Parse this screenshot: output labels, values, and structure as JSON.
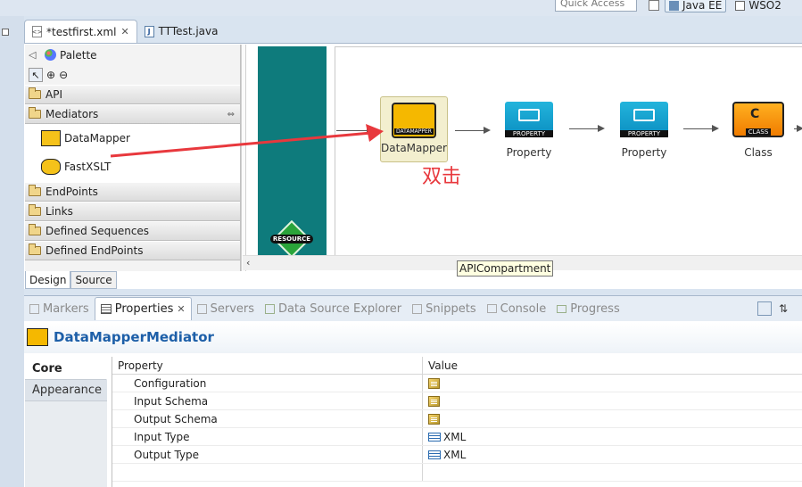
{
  "top": {
    "quick_access": "Quick Access",
    "perspectives": [
      "Java EE",
      "WSO2"
    ]
  },
  "editor_tabs": [
    {
      "label": "*testfirst.xml",
      "active": true
    },
    {
      "label": "TTTest.java",
      "active": false
    }
  ],
  "palette": {
    "title": "Palette",
    "drawers": {
      "api": "API",
      "mediators": "Mediators",
      "endpoints": "EndPoints",
      "links": "Links",
      "defined_sequences": "Defined Sequences",
      "defined_endpoints": "Defined EndPoints"
    },
    "tools": [
      "DataMapper",
      "FastXSLT"
    ]
  },
  "canvas": {
    "resource_label": "RESOURCE",
    "mediators": [
      {
        "label": "DataMapper",
        "badge": "DATAMAPPER"
      },
      {
        "label": "Property",
        "badge": "PROPERTY"
      },
      {
        "label": "Property",
        "badge": "PROPERTY"
      },
      {
        "label": "Class",
        "badge": "CLASS"
      }
    ],
    "annotation": "双击",
    "tooltip": "APICompartment",
    "annotation_color": "#e8383d"
  },
  "editor_bottom_tabs": [
    "Design",
    "Source"
  ],
  "view_tabs": [
    "Markers",
    "Properties",
    "Servers",
    "Data Source Explorer",
    "Snippets",
    "Console",
    "Progress"
  ],
  "properties": {
    "title": "DataMapperMediator",
    "side_tabs": [
      "Core",
      "Appearance"
    ],
    "headers": [
      "Property",
      "Value"
    ],
    "rows": [
      {
        "name": "Configuration",
        "value": ""
      },
      {
        "name": "Input Schema",
        "value": ""
      },
      {
        "name": "Output Schema",
        "value": ""
      },
      {
        "name": "Input Type",
        "value": "XML"
      },
      {
        "name": "Output Type",
        "value": "XML"
      }
    ]
  }
}
